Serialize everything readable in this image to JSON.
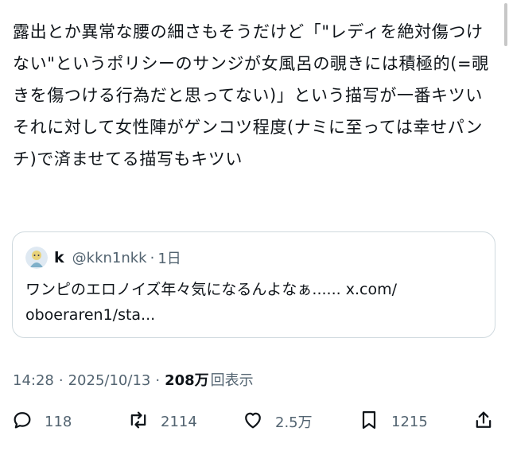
{
  "tweet": {
    "text": "露出とか異常な腰の細さもそうだけど「\"レディを絶対傷つけない\"というポリシーのサンジが女風呂の覗きには積極的(=覗きを傷つける行為だと思ってない)」という描写が一番キツい\nそれに対して女性陣がゲンコツ程度(ナミに至っては幸せパンチ)で済ませてる描写もキツい"
  },
  "quote": {
    "name": "k",
    "handle": "@kkn1nkk",
    "separator": "·",
    "age": "1日",
    "body": "ワンピのエロノイズ年々気になるんよなぁ...... x.com/\noboeraren1/sta..."
  },
  "meta": {
    "time": "14:28",
    "separator1": "·",
    "date": "2025/10/13",
    "separator2": "·",
    "views_count": "208万",
    "views_label": "回表示"
  },
  "actions": {
    "replies": "118",
    "reposts": "2114",
    "likes": "2.5万",
    "bookmarks": "1215"
  },
  "icons": {
    "reply": "speech-bubble-icon",
    "repost": "repost-arrows-icon",
    "like": "heart-icon",
    "bookmark": "bookmark-icon",
    "share": "share-upload-icon"
  },
  "colors": {
    "text": "#0f1419",
    "secondary": "#536471",
    "border": "#cfd9de"
  }
}
